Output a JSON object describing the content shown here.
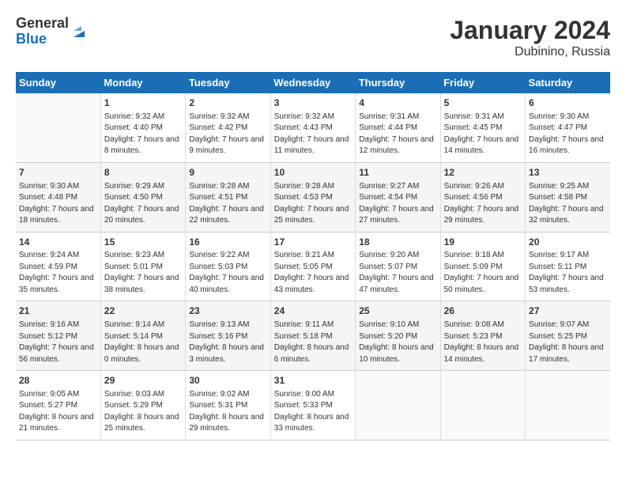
{
  "logo": {
    "line1": "General",
    "line2": "Blue"
  },
  "title": "January 2024",
  "subtitle": "Dubinino, Russia",
  "weekdays": [
    "Sunday",
    "Monday",
    "Tuesday",
    "Wednesday",
    "Thursday",
    "Friday",
    "Saturday"
  ],
  "weeks": [
    [
      {
        "day": "",
        "sunrise": "",
        "sunset": "",
        "daylight": ""
      },
      {
        "day": "1",
        "sunrise": "Sunrise: 9:32 AM",
        "sunset": "Sunset: 4:40 PM",
        "daylight": "Daylight: 7 hours and 8 minutes."
      },
      {
        "day": "2",
        "sunrise": "Sunrise: 9:32 AM",
        "sunset": "Sunset: 4:42 PM",
        "daylight": "Daylight: 7 hours and 9 minutes."
      },
      {
        "day": "3",
        "sunrise": "Sunrise: 9:32 AM",
        "sunset": "Sunset: 4:43 PM",
        "daylight": "Daylight: 7 hours and 11 minutes."
      },
      {
        "day": "4",
        "sunrise": "Sunrise: 9:31 AM",
        "sunset": "Sunset: 4:44 PM",
        "daylight": "Daylight: 7 hours and 12 minutes."
      },
      {
        "day": "5",
        "sunrise": "Sunrise: 9:31 AM",
        "sunset": "Sunset: 4:45 PM",
        "daylight": "Daylight: 7 hours and 14 minutes."
      },
      {
        "day": "6",
        "sunrise": "Sunrise: 9:30 AM",
        "sunset": "Sunset: 4:47 PM",
        "daylight": "Daylight: 7 hours and 16 minutes."
      }
    ],
    [
      {
        "day": "7",
        "sunrise": "Sunrise: 9:30 AM",
        "sunset": "Sunset: 4:48 PM",
        "daylight": "Daylight: 7 hours and 18 minutes."
      },
      {
        "day": "8",
        "sunrise": "Sunrise: 9:29 AM",
        "sunset": "Sunset: 4:50 PM",
        "daylight": "Daylight: 7 hours and 20 minutes."
      },
      {
        "day": "9",
        "sunrise": "Sunrise: 9:28 AM",
        "sunset": "Sunset: 4:51 PM",
        "daylight": "Daylight: 7 hours and 22 minutes."
      },
      {
        "day": "10",
        "sunrise": "Sunrise: 9:28 AM",
        "sunset": "Sunset: 4:53 PM",
        "daylight": "Daylight: 7 hours and 25 minutes."
      },
      {
        "day": "11",
        "sunrise": "Sunrise: 9:27 AM",
        "sunset": "Sunset: 4:54 PM",
        "daylight": "Daylight: 7 hours and 27 minutes."
      },
      {
        "day": "12",
        "sunrise": "Sunrise: 9:26 AM",
        "sunset": "Sunset: 4:56 PM",
        "daylight": "Daylight: 7 hours and 29 minutes."
      },
      {
        "day": "13",
        "sunrise": "Sunrise: 9:25 AM",
        "sunset": "Sunset: 4:58 PM",
        "daylight": "Daylight: 7 hours and 32 minutes."
      }
    ],
    [
      {
        "day": "14",
        "sunrise": "Sunrise: 9:24 AM",
        "sunset": "Sunset: 4:59 PM",
        "daylight": "Daylight: 7 hours and 35 minutes."
      },
      {
        "day": "15",
        "sunrise": "Sunrise: 9:23 AM",
        "sunset": "Sunset: 5:01 PM",
        "daylight": "Daylight: 7 hours and 38 minutes."
      },
      {
        "day": "16",
        "sunrise": "Sunrise: 9:22 AM",
        "sunset": "Sunset: 5:03 PM",
        "daylight": "Daylight: 7 hours and 40 minutes."
      },
      {
        "day": "17",
        "sunrise": "Sunrise: 9:21 AM",
        "sunset": "Sunset: 5:05 PM",
        "daylight": "Daylight: 7 hours and 43 minutes."
      },
      {
        "day": "18",
        "sunrise": "Sunrise: 9:20 AM",
        "sunset": "Sunset: 5:07 PM",
        "daylight": "Daylight: 7 hours and 47 minutes."
      },
      {
        "day": "19",
        "sunrise": "Sunrise: 9:18 AM",
        "sunset": "Sunset: 5:09 PM",
        "daylight": "Daylight: 7 hours and 50 minutes."
      },
      {
        "day": "20",
        "sunrise": "Sunrise: 9:17 AM",
        "sunset": "Sunset: 5:11 PM",
        "daylight": "Daylight: 7 hours and 53 minutes."
      }
    ],
    [
      {
        "day": "21",
        "sunrise": "Sunrise: 9:16 AM",
        "sunset": "Sunset: 5:12 PM",
        "daylight": "Daylight: 7 hours and 56 minutes."
      },
      {
        "day": "22",
        "sunrise": "Sunrise: 9:14 AM",
        "sunset": "Sunset: 5:14 PM",
        "daylight": "Daylight: 8 hours and 0 minutes."
      },
      {
        "day": "23",
        "sunrise": "Sunrise: 9:13 AM",
        "sunset": "Sunset: 5:16 PM",
        "daylight": "Daylight: 8 hours and 3 minutes."
      },
      {
        "day": "24",
        "sunrise": "Sunrise: 9:11 AM",
        "sunset": "Sunset: 5:18 PM",
        "daylight": "Daylight: 8 hours and 6 minutes."
      },
      {
        "day": "25",
        "sunrise": "Sunrise: 9:10 AM",
        "sunset": "Sunset: 5:20 PM",
        "daylight": "Daylight: 8 hours and 10 minutes."
      },
      {
        "day": "26",
        "sunrise": "Sunrise: 9:08 AM",
        "sunset": "Sunset: 5:23 PM",
        "daylight": "Daylight: 8 hours and 14 minutes."
      },
      {
        "day": "27",
        "sunrise": "Sunrise: 9:07 AM",
        "sunset": "Sunset: 5:25 PM",
        "daylight": "Daylight: 8 hours and 17 minutes."
      }
    ],
    [
      {
        "day": "28",
        "sunrise": "Sunrise: 9:05 AM",
        "sunset": "Sunset: 5:27 PM",
        "daylight": "Daylight: 8 hours and 21 minutes."
      },
      {
        "day": "29",
        "sunrise": "Sunrise: 9:03 AM",
        "sunset": "Sunset: 5:29 PM",
        "daylight": "Daylight: 8 hours and 25 minutes."
      },
      {
        "day": "30",
        "sunrise": "Sunrise: 9:02 AM",
        "sunset": "Sunset: 5:31 PM",
        "daylight": "Daylight: 8 hours and 29 minutes."
      },
      {
        "day": "31",
        "sunrise": "Sunrise: 9:00 AM",
        "sunset": "Sunset: 5:33 PM",
        "daylight": "Daylight: 8 hours and 33 minutes."
      },
      {
        "day": "",
        "sunrise": "",
        "sunset": "",
        "daylight": ""
      },
      {
        "day": "",
        "sunrise": "",
        "sunset": "",
        "daylight": ""
      },
      {
        "day": "",
        "sunrise": "",
        "sunset": "",
        "daylight": ""
      }
    ]
  ]
}
